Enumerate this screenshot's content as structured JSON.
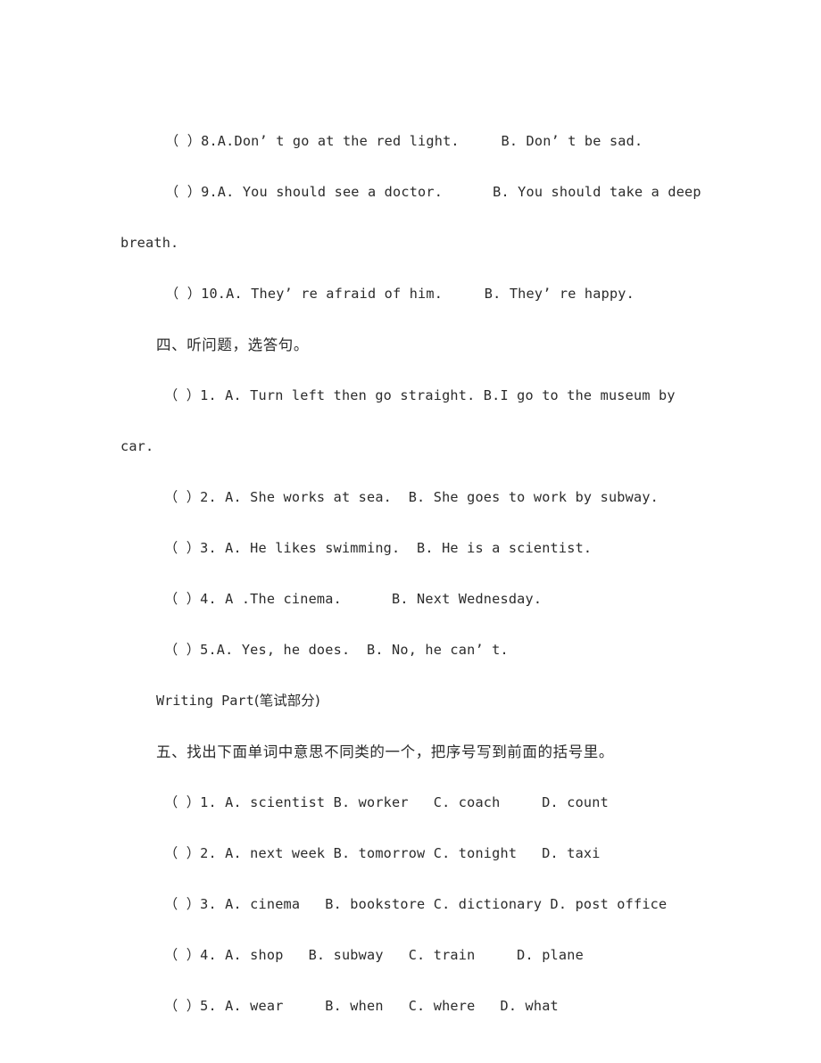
{
  "document": {
    "type": "english-exam-worksheet",
    "page_background": "#ffffff",
    "text_color": "#2b2b2b"
  },
  "listening_section_three_tail": {
    "items": [
      {
        "id": "item-8",
        "text": "（ ）8.A.Don’ t go at the red light.     B. Don’ t be sad."
      },
      {
        "id": "item-9",
        "text": "（ ）9.A. You should see a doctor.      B. You should take a deep",
        "continuation": "breath."
      },
      {
        "id": "item-10",
        "text": "（ ）10.A. They’ re afraid of him.     B. They’ re happy."
      }
    ]
  },
  "section_four": {
    "heading": "四、听问题，选答句。",
    "items": [
      {
        "id": "item-1",
        "text": "（ ）1. A. Turn left then go straight. B.I go to the museum by car."
      },
      {
        "id": "item-2",
        "text": "（ ）2. A. She works at sea.  B. She goes to work by subway."
      },
      {
        "id": "item-3",
        "text": "（ ）3. A. He likes swimming.  B. He is a scientist."
      },
      {
        "id": "item-4",
        "text": "（ ）4. A .The cinema.      B. Next Wednesday."
      },
      {
        "id": "item-5",
        "text": "（ ）5.A. Yes, he does.  B. No, he can’ t."
      }
    ]
  },
  "writing_part": {
    "label_en": "Writing Part",
    "label_cn": "(笔试部分)"
  },
  "section_five": {
    "heading": "五、找出下面单词中意思不同类的一个，把序号写到前面的括号里。",
    "items": [
      {
        "id": "item-1",
        "text": "（ ）1. A. scientist B. worker   C. coach     D. count"
      },
      {
        "id": "item-2",
        "text": "（ ）2. A. next week B. tomorrow C. tonight   D. taxi"
      },
      {
        "id": "item-3",
        "text": "（ ）3. A. cinema   B. bookstore C. dictionary D. post office"
      },
      {
        "id": "item-4",
        "text": "（ ）4. A. shop   B. subway   C. train     D. plane"
      },
      {
        "id": "item-5",
        "text": "（ ）5. A. wear     B. when   C. where   D. what"
      }
    ]
  }
}
